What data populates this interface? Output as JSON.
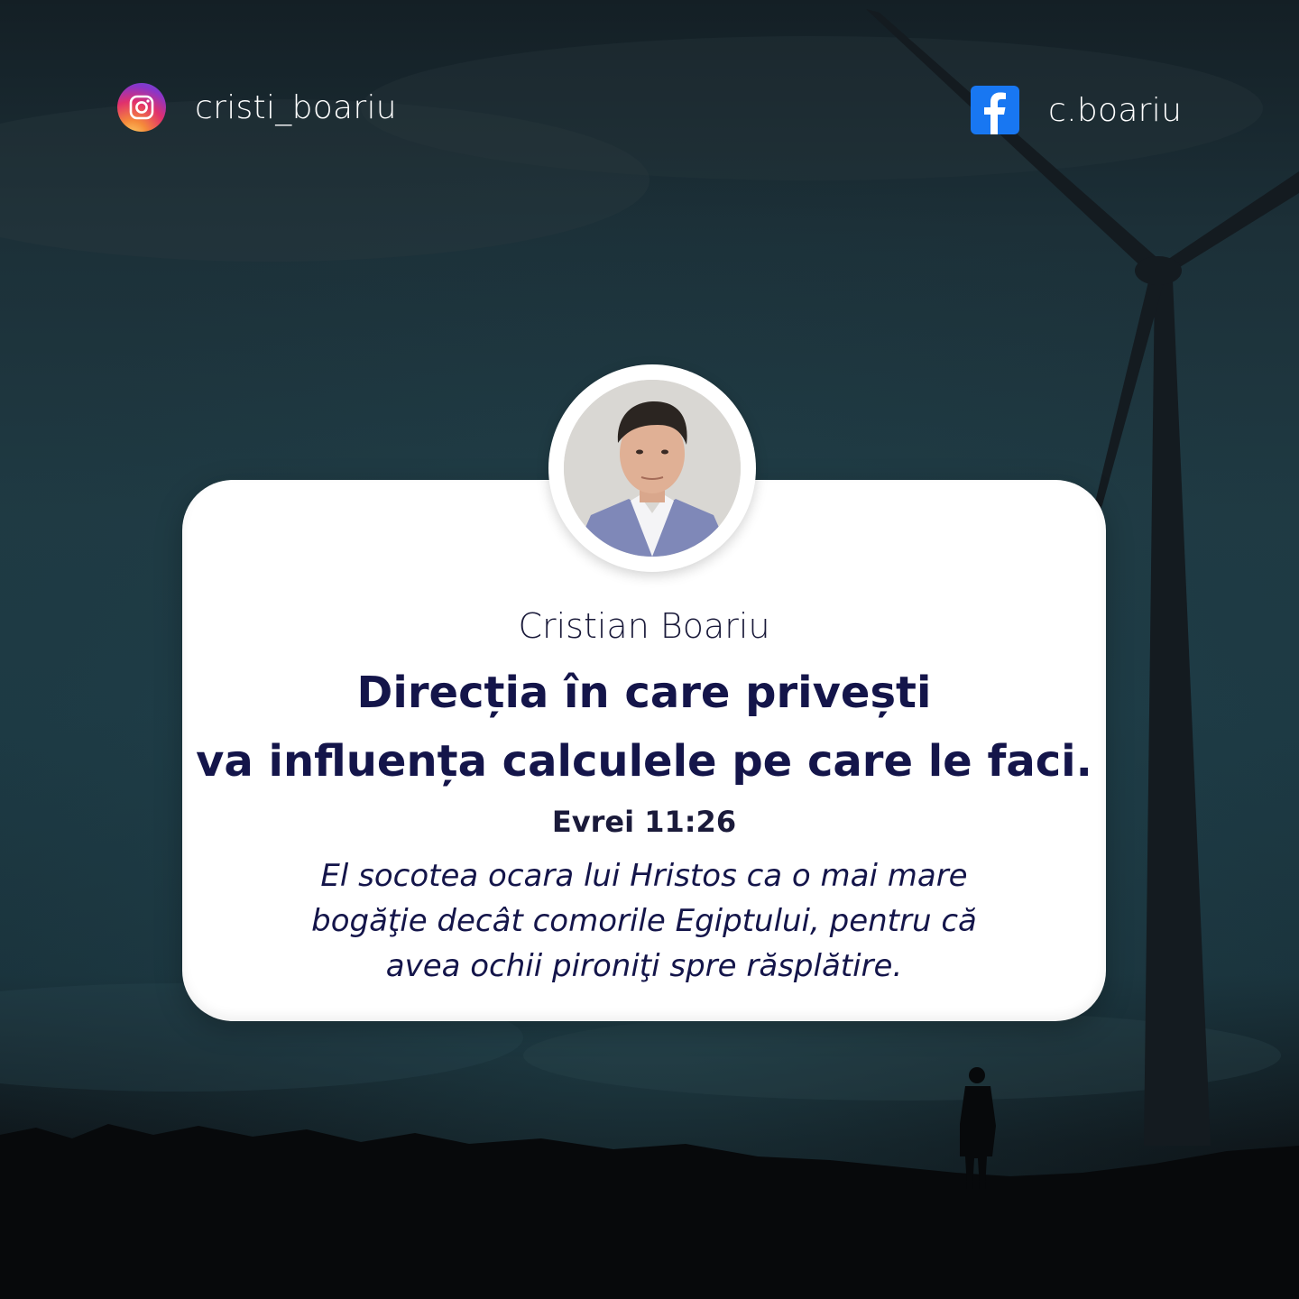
{
  "social": {
    "instagram": {
      "icon": "instagram-icon",
      "handle": "cristi_boariu"
    },
    "facebook": {
      "icon": "facebook-icon",
      "handle": "c.boariu"
    }
  },
  "card": {
    "avatar": "author-photo",
    "author": "Cristian Boariu",
    "headline_line1": "Direcția în care privești",
    "headline_line2": "va influența calculele pe care le faci.",
    "reference": "Evrei 11:26",
    "verse_line1": "El socotea ocara lui Hristos ca o mai mare",
    "verse_line2": "bogăţie decât comorile Egiptului, pentru că",
    "verse_line3": "avea ochii pironiţi spre răsplătire."
  },
  "colors": {
    "sky": "#1f3a43",
    "card": "#ffffff",
    "text_dark": "#14154a",
    "facebook_blue": "#1877f2"
  }
}
